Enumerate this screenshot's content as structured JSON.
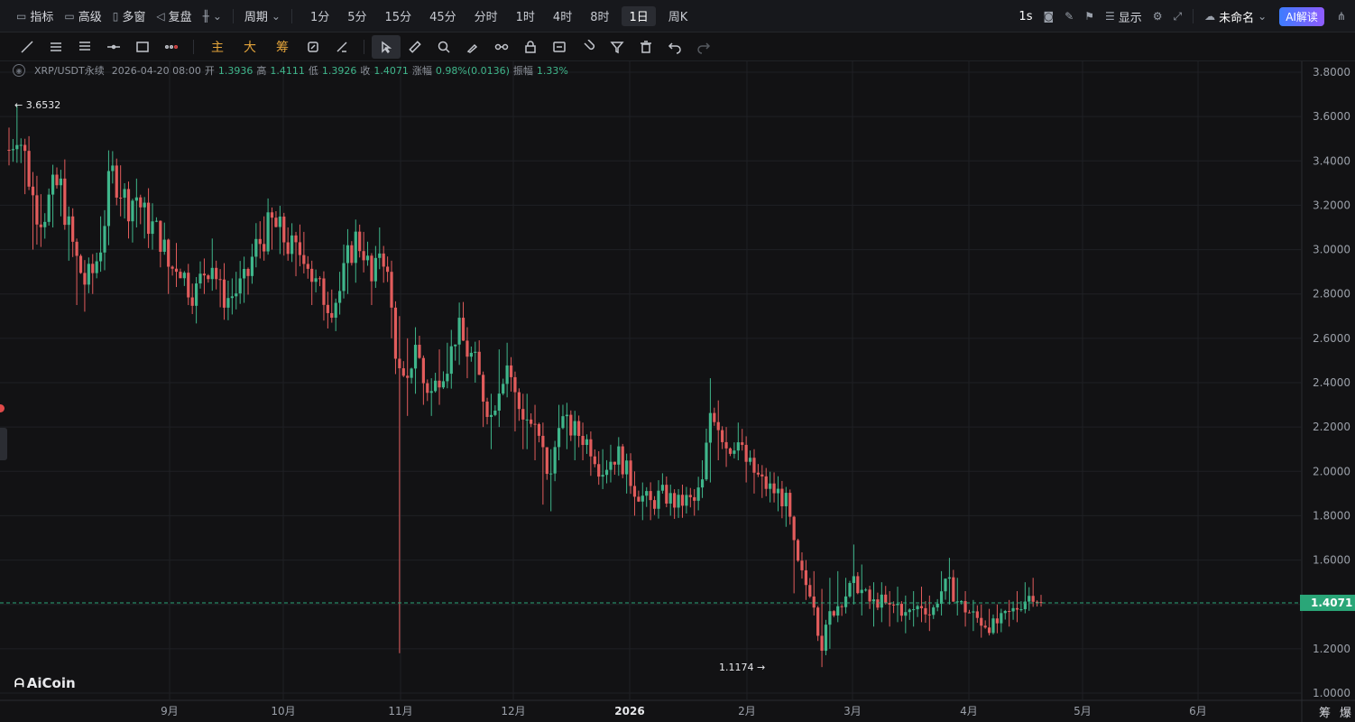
{
  "topbar": {
    "indicators": "指标",
    "advanced": "高级",
    "multi_window": "多窗",
    "replay": "复盘",
    "period_menu": "周期",
    "periods": [
      "1分",
      "5分",
      "15分",
      "45分",
      "分时",
      "1时",
      "4时",
      "8时",
      "1日",
      "周K"
    ],
    "active_period": "1日",
    "interval": "1s",
    "display": "显示",
    "layout_name": "未命名",
    "ai_button": "AI解读"
  },
  "drawbar": {
    "main": "主",
    "big": "大",
    "chips": "筹"
  },
  "legend": {
    "symbol": "XRP/USDT永续",
    "datetime": "2026-04-20 08:00",
    "open_label": "开",
    "open": "1.3936",
    "high_label": "高",
    "high": "1.4111",
    "low_label": "低",
    "low": "1.3926",
    "close_label": "收",
    "close": "1.4071",
    "change_label": "涨幅",
    "change": "0.98%(0.0136)",
    "amp_label": "振幅",
    "amp": "1.33%"
  },
  "logo": "AiCoin",
  "bottom_right": [
    "筹",
    "爆"
  ],
  "colors": {
    "up": "#3fb68b",
    "down": "#e25c5c",
    "bg": "#121214",
    "grid": "#1f2024",
    "price_tag": "#2aa678"
  },
  "chart_data": {
    "type": "candlestick",
    "symbol": "XRP/USDT永续",
    "yticks": [
      "3.8000",
      "3.6000",
      "3.4000",
      "3.2000",
      "3.0000",
      "2.8000",
      "2.6000",
      "2.4000",
      "2.2000",
      "2.0000",
      "1.8000",
      "1.6000",
      "1.4000",
      "1.2000",
      "1.0000"
    ],
    "ylim": [
      1.0,
      3.8
    ],
    "xticks": [
      "9月",
      "10月",
      "11月",
      "12月",
      "2026",
      "2月",
      "3月",
      "4月",
      "5月",
      "6月"
    ],
    "last_price": "1.4071",
    "high_marker": "3.6532",
    "low_marker": "1.1174",
    "close_path": [
      3.45,
      3.55,
      3.4,
      3.2,
      3.15,
      3.25,
      3.3,
      3.1,
      2.95,
      2.85,
      2.9,
      3.05,
      3.35,
      3.3,
      3.2,
      3.25,
      3.15,
      3.1,
      3.05,
      2.9,
      2.95,
      2.85,
      2.8,
      2.9,
      2.95,
      2.8,
      2.78,
      2.82,
      2.85,
      3.0,
      3.05,
      3.12,
      3.08,
      3.02,
      2.98,
      3.0,
      2.85,
      2.8,
      2.75,
      2.8,
      2.95,
      3.05,
      3.0,
      2.82,
      3.05,
      2.8,
      2.45,
      2.35,
      2.6,
      2.4,
      2.35,
      2.45,
      2.5,
      2.65,
      2.55,
      2.5,
      2.35,
      2.25,
      2.4,
      2.5,
      2.3,
      2.25,
      2.2,
      2.1,
      1.95,
      2.25,
      2.2,
      2.18,
      2.15,
      2.1,
      2.0,
      2.05,
      2.08,
      2.0,
      1.92,
      1.88,
      1.85,
      1.9,
      1.88,
      1.85,
      1.87,
      1.86,
      1.95,
      2.3,
      2.2,
      2.1,
      2.15,
      2.05,
      2.0,
      1.95,
      1.92,
      1.9,
      1.85,
      1.6,
      1.5,
      1.45,
      1.2,
      1.35,
      1.4,
      1.45,
      1.5,
      1.45,
      1.4,
      1.42,
      1.38,
      1.4,
      1.35,
      1.38,
      1.4,
      1.35,
      1.45,
      1.5,
      1.42,
      1.38,
      1.35,
      1.32,
      1.3,
      1.32,
      1.35,
      1.38,
      1.42,
      1.45,
      1.41
    ],
    "high_path": [
      3.55,
      3.6532,
      3.5,
      3.35,
      3.25,
      3.38,
      3.36,
      3.18,
      3.05,
      2.95,
      2.98,
      3.15,
      3.38,
      3.38,
      3.28,
      3.3,
      3.22,
      3.16,
      3.12,
      2.99,
      3.03,
      2.93,
      2.87,
      2.96,
      3.05,
      2.89,
      2.86,
      2.9,
      2.94,
      3.1,
      3.15,
      3.19,
      3.15,
      3.1,
      3.05,
      3.08,
      2.95,
      2.88,
      2.82,
      2.9,
      3.05,
      3.1,
      3.08,
      2.95,
      3.1,
      2.95,
      2.7,
      2.6,
      2.65,
      2.5,
      2.42,
      2.55,
      2.58,
      2.7,
      2.65,
      2.58,
      2.45,
      2.35,
      2.55,
      2.58,
      2.42,
      2.35,
      2.3,
      2.22,
      2.1,
      2.3,
      2.28,
      2.25,
      2.22,
      2.18,
      2.1,
      2.12,
      2.15,
      2.08,
      2.0,
      1.95,
      1.92,
      1.96,
      1.94,
      1.92,
      1.93,
      1.92,
      2.05,
      2.42,
      2.32,
      2.2,
      2.22,
      2.15,
      2.1,
      2.02,
      1.98,
      1.97,
      1.93,
      1.75,
      1.6,
      1.55,
      1.47,
      1.52,
      1.55,
      1.52,
      1.67,
      1.58,
      1.5,
      1.5,
      1.46,
      1.48,
      1.44,
      1.46,
      1.48,
      1.44,
      1.55,
      1.61,
      1.52,
      1.46,
      1.42,
      1.4,
      1.38,
      1.4,
      1.42,
      1.46,
      1.5,
      1.52,
      1.42
    ],
    "low_path": [
      3.38,
      3.4,
      3.25,
      3.0,
      3.05,
      3.1,
      3.15,
      2.95,
      2.75,
      2.72,
      2.8,
      2.9,
      3.2,
      3.15,
      3.05,
      3.1,
      3.05,
      3.0,
      2.92,
      2.8,
      2.85,
      2.78,
      2.7,
      2.8,
      2.85,
      2.74,
      2.7,
      2.76,
      2.76,
      2.92,
      2.95,
      3.0,
      2.98,
      2.95,
      2.88,
      2.9,
      2.75,
      2.68,
      2.7,
      2.72,
      2.8,
      2.95,
      2.9,
      2.75,
      2.95,
      2.6,
      1.18,
      2.25,
      2.35,
      2.3,
      2.25,
      2.3,
      2.4,
      2.48,
      2.42,
      2.4,
      2.2,
      2.1,
      2.2,
      2.38,
      2.18,
      2.1,
      2.05,
      1.85,
      1.82,
      2.05,
      2.1,
      2.05,
      2.05,
      1.98,
      1.92,
      1.95,
      1.98,
      1.9,
      1.8,
      1.78,
      1.78,
      1.82,
      1.8,
      1.79,
      1.81,
      1.8,
      1.88,
      1.95,
      2.05,
      2.02,
      2.05,
      1.95,
      1.9,
      1.88,
      1.86,
      1.82,
      1.75,
      1.45,
      1.42,
      1.35,
      1.1174,
      1.2,
      1.32,
      1.38,
      1.4,
      1.35,
      1.3,
      1.32,
      1.3,
      1.32,
      1.27,
      1.3,
      1.32,
      1.28,
      1.35,
      1.4,
      1.35,
      1.3,
      1.28,
      1.25,
      1.26,
      1.27,
      1.3,
      1.32,
      1.36,
      1.4,
      1.39
    ]
  }
}
